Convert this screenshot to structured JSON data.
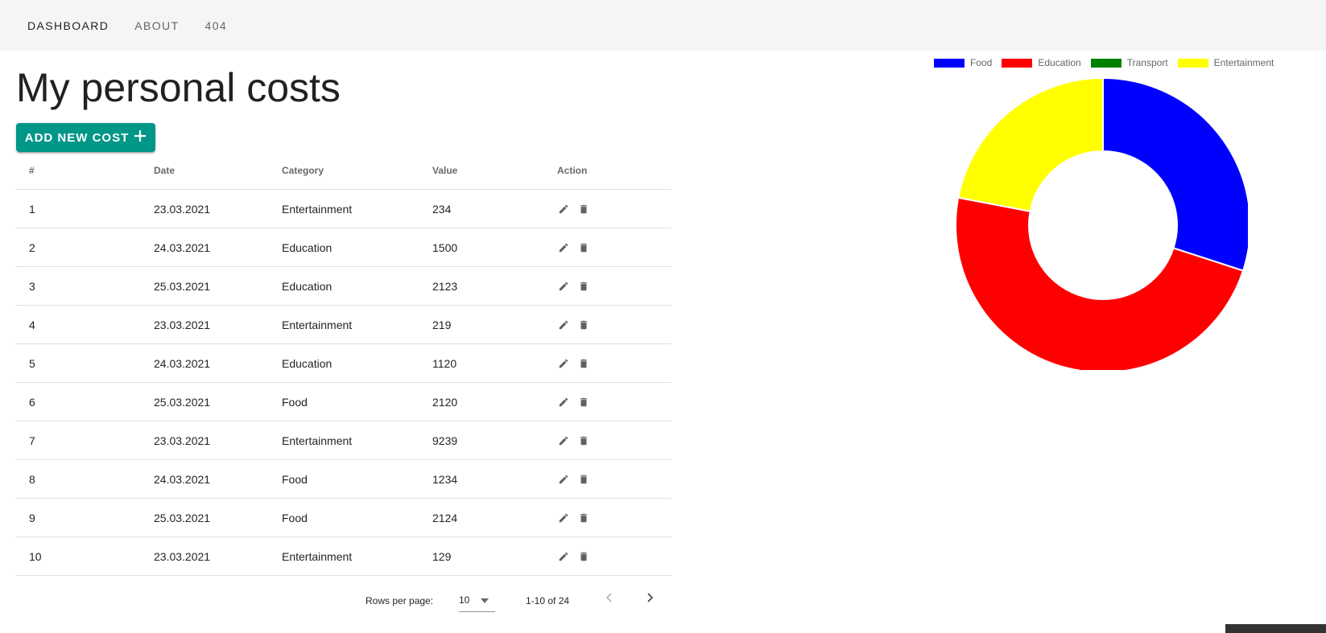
{
  "nav": {
    "items": [
      {
        "label": "DASHBOARD",
        "active": true
      },
      {
        "label": "ABOUT",
        "active": false
      },
      {
        "label": "404",
        "active": false
      }
    ]
  },
  "page": {
    "title": "My personal costs",
    "add_button_label": "ADD NEW COST",
    "add_button_icon": "plus-icon"
  },
  "table": {
    "headers": [
      "#",
      "Date",
      "Category",
      "Value",
      "Action"
    ],
    "rows": [
      {
        "n": "1",
        "date": "23.03.2021",
        "category": "Entertainment",
        "value": "234"
      },
      {
        "n": "2",
        "date": "24.03.2021",
        "category": "Education",
        "value": "1500"
      },
      {
        "n": "3",
        "date": "25.03.2021",
        "category": "Education",
        "value": "2123"
      },
      {
        "n": "4",
        "date": "23.03.2021",
        "category": "Entertainment",
        "value": "219"
      },
      {
        "n": "5",
        "date": "24.03.2021",
        "category": "Education",
        "value": "1120"
      },
      {
        "n": "6",
        "date": "25.03.2021",
        "category": "Food",
        "value": "2120"
      },
      {
        "n": "7",
        "date": "23.03.2021",
        "category": "Entertainment",
        "value": "9239"
      },
      {
        "n": "8",
        "date": "24.03.2021",
        "category": "Food",
        "value": "1234"
      },
      {
        "n": "9",
        "date": "25.03.2021",
        "category": "Food",
        "value": "2124"
      },
      {
        "n": "10",
        "date": "23.03.2021",
        "category": "Entertainment",
        "value": "129"
      }
    ],
    "action_icons": [
      "pencil-icon",
      "trash-icon"
    ]
  },
  "pagination": {
    "rows_per_page_label": "Rows per page:",
    "rows_per_page_value": "10",
    "range_label": "1-10 of 24"
  },
  "chart_data": {
    "type": "pie",
    "variant": "doughnut",
    "legend_position": "top",
    "categories": [
      "Food",
      "Education",
      "Transport",
      "Entertainment"
    ],
    "values": [
      30,
      48,
      0,
      22
    ],
    "colors": [
      "#0000ff",
      "#ff0000",
      "#008000",
      "#ffff00"
    ]
  },
  "colors": {
    "accent": "#009688",
    "topbar_bg": "#f5f5f5"
  }
}
